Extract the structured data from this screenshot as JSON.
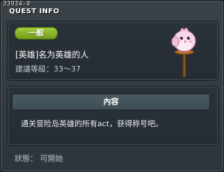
{
  "window": {
    "quest_id": "33934-0",
    "title": "QUEST INFO"
  },
  "quest": {
    "category_badge": "一般",
    "name": "[英雄]名为英雄的人",
    "recommended_level": "建議等級：33～37",
    "npc_icon": "pink-bird-on-perch-icon"
  },
  "content": {
    "header": "內容",
    "text": "通关冒险岛英雄的所有act，获得称号吧。"
  },
  "status": {
    "text": "狀態： 可開始"
  },
  "colors": {
    "badge_green": "#8ab82a",
    "window_bg": "#30383d",
    "panel_bg": "#262d33"
  }
}
